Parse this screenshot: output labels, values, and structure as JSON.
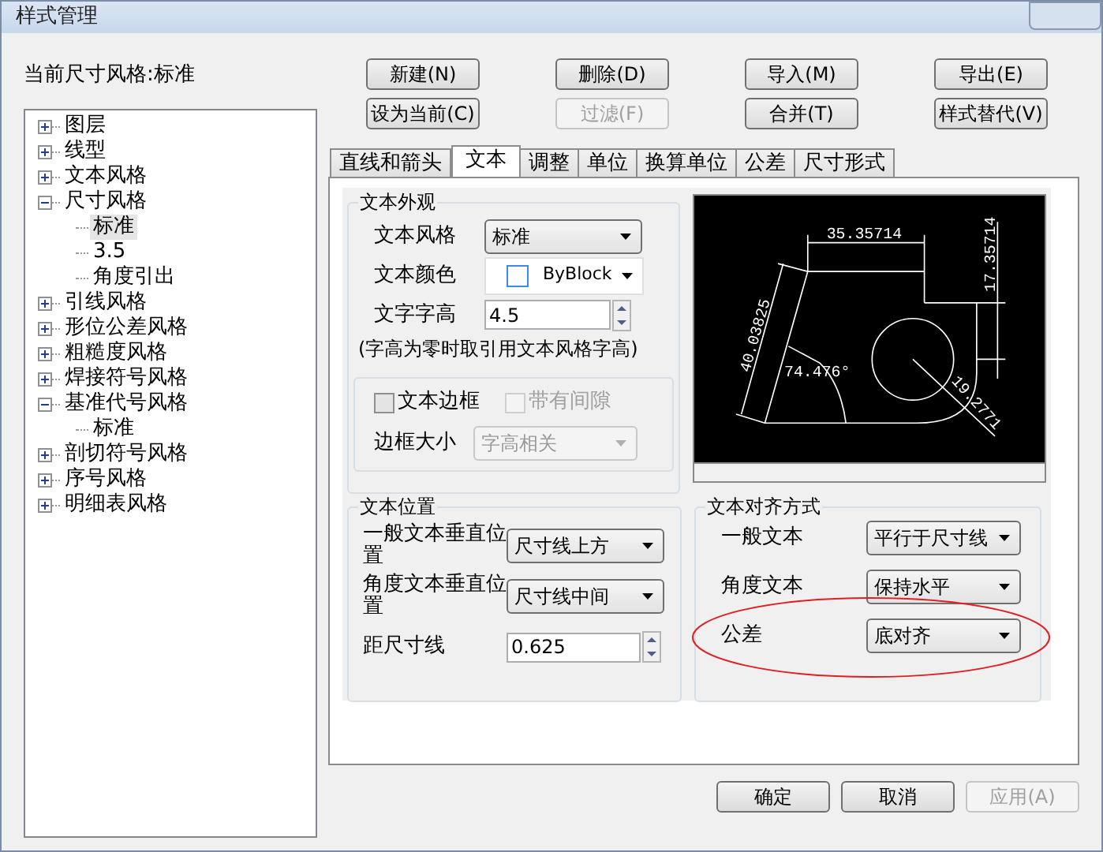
{
  "window": {
    "title": "样式管理"
  },
  "current_style": "当前尺寸风格:标准",
  "tree": [
    {
      "label": "图层",
      "expanded": false,
      "selected": false
    },
    {
      "label": "线型",
      "expanded": false,
      "selected": false
    },
    {
      "label": "文本风格",
      "expanded": false,
      "selected": false
    },
    {
      "label": "尺寸风格",
      "expanded": true,
      "selected": false,
      "children": [
        {
          "label": "标准",
          "selected": true
        },
        {
          "label": "3.5",
          "selected": false
        },
        {
          "label": "角度引出",
          "selected": false
        }
      ]
    },
    {
      "label": "引线风格",
      "expanded": false,
      "selected": false
    },
    {
      "label": "形位公差风格",
      "expanded": false,
      "selected": false
    },
    {
      "label": "粗糙度风格",
      "expanded": false,
      "selected": false
    },
    {
      "label": "焊接符号风格",
      "expanded": false,
      "selected": false
    },
    {
      "label": "基准代号风格",
      "expanded": true,
      "selected": false,
      "children": [
        {
          "label": "标准",
          "selected": false
        }
      ]
    },
    {
      "label": "剖切符号风格",
      "expanded": false,
      "selected": false
    },
    {
      "label": "序号风格",
      "expanded": false,
      "selected": false
    },
    {
      "label": "明细表风格",
      "expanded": false,
      "selected": false
    }
  ],
  "buttons": [
    {
      "label": "新建(N)",
      "disabled": false
    },
    {
      "label": "删除(D)",
      "disabled": false
    },
    {
      "label": "导入(M)",
      "disabled": false
    },
    {
      "label": "导出(E)",
      "disabled": false
    },
    {
      "label": "设为当前(C)",
      "disabled": false
    },
    {
      "label": "过滤(F)",
      "disabled": true
    },
    {
      "label": "合并(T)",
      "disabled": false
    },
    {
      "label": "样式替代(V)",
      "disabled": false
    }
  ],
  "tabs": [
    {
      "label": "直线和箭头",
      "selected": false
    },
    {
      "label": "文本",
      "selected": true
    },
    {
      "label": "调整",
      "selected": false
    },
    {
      "label": "单位",
      "selected": false
    },
    {
      "label": "换算单位",
      "selected": false
    },
    {
      "label": "公差",
      "selected": false
    },
    {
      "label": "尺寸形式",
      "selected": false
    }
  ],
  "appearance": {
    "title": "文本外观",
    "fields": [
      {
        "kind": "select",
        "label": "文本风格",
        "value": "标准"
      },
      {
        "kind": "color",
        "label": "文本颜色",
        "value": "ByBlock"
      },
      {
        "kind": "spin",
        "label": "文字字高",
        "value": "4.5"
      }
    ],
    "note": "(字高为零时取引用文本风格字高)",
    "frame": {
      "checkboxes": [
        {
          "label": "文本边框",
          "checked": false,
          "disabled": false
        },
        {
          "label": "带有间隙",
          "checked": false,
          "disabled": true
        }
      ],
      "size": {
        "kind": "select",
        "label": "边框大小",
        "value": "字高相关",
        "disabled": true
      }
    }
  },
  "preview": {
    "labels": [
      "35.35714",
      "17.35714",
      "40.03825",
      "74.476°",
      "19.2771"
    ]
  },
  "position": {
    "title": "文本位置",
    "fields": [
      {
        "kind": "select",
        "label": "一般文本垂直位置",
        "value": "尺寸线上方"
      },
      {
        "kind": "select",
        "label": "角度文本垂直位置",
        "value": "尺寸线中间"
      },
      {
        "kind": "spin",
        "label": "距尺寸线",
        "value": "0.625"
      }
    ]
  },
  "alignment": {
    "title": "文本对齐方式",
    "fields": [
      {
        "kind": "select",
        "label": "一般文本",
        "value": "平行于尺寸线"
      },
      {
        "kind": "select",
        "label": "角度文本",
        "value": "保持水平"
      },
      {
        "kind": "select",
        "label": "公差",
        "value": "底对齐"
      }
    ]
  },
  "footer_buttons": [
    {
      "label": "确定",
      "disabled": false
    },
    {
      "label": "取消",
      "disabled": false
    },
    {
      "label": "应用(A)",
      "disabled": true
    }
  ]
}
